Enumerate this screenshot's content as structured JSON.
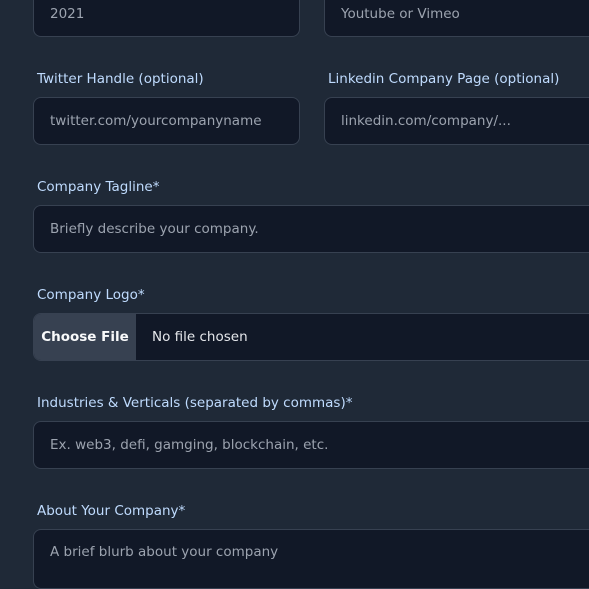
{
  "fields": {
    "year": {
      "value": "2021"
    },
    "video": {
      "placeholder": "Youtube or Vimeo"
    },
    "twitter": {
      "label": "Twitter Handle (optional)",
      "placeholder": "twitter.com/yourcompanyname"
    },
    "linkedin": {
      "label": "Linkedin Company Page (optional)",
      "placeholder": "linkedin.com/company/..."
    },
    "tagline": {
      "label": "Company Tagline*",
      "placeholder": "Briefly describe your company."
    },
    "logo": {
      "label": "Company Logo*",
      "button_label": "Choose File",
      "status": "No file chosen"
    },
    "industries": {
      "label": "Industries & Verticals (separated by commas)*",
      "placeholder": "Ex. web3, defi, gamging, blockchain, etc."
    },
    "about": {
      "label": "About Your Company*",
      "placeholder": "A brief blurb about your company"
    }
  }
}
